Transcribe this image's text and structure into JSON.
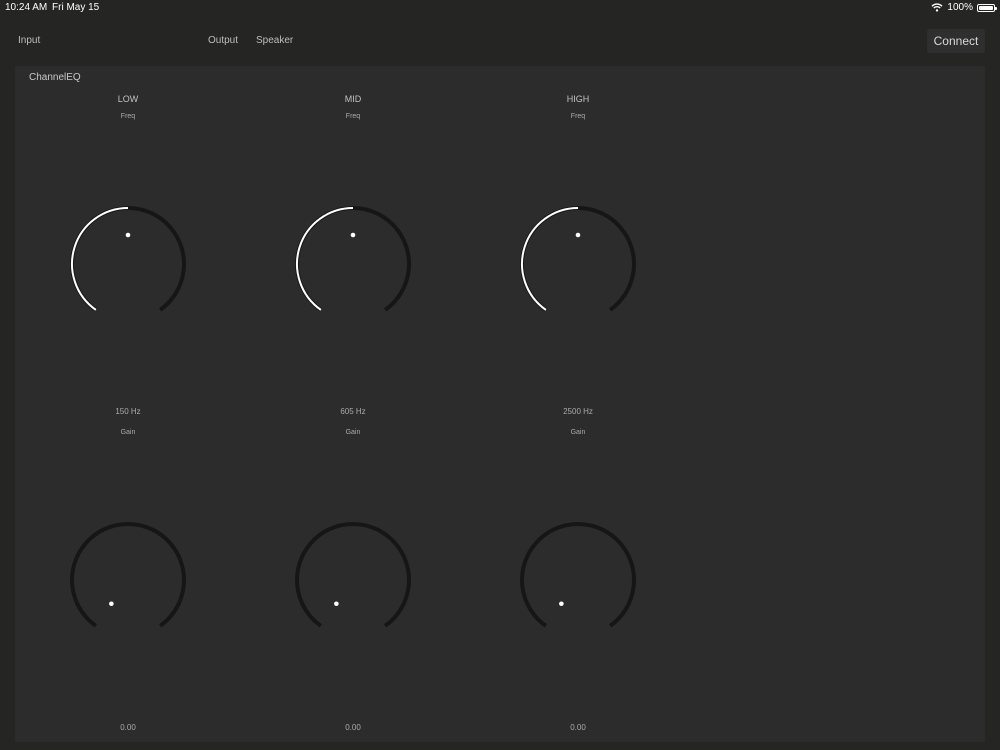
{
  "status": {
    "time": "10:24 AM",
    "date": "Fri May 15",
    "battery": "100%"
  },
  "toolbar": {
    "input_label": "Input",
    "output_label": "Output",
    "speaker_label": "Speaker",
    "connect_label": "Connect"
  },
  "panel": {
    "title": "ChannelEQ",
    "bands": [
      {
        "name": "LOW",
        "freq_label": "Freq",
        "freq_value": "150 Hz",
        "gain_label": "Gain",
        "gain_value": "0.00",
        "freq_level": 0.5,
        "gain_level": 0.0
      },
      {
        "name": "MID",
        "freq_label": "Freq",
        "freq_value": "605 Hz",
        "gain_label": "Gain",
        "gain_value": "0.00",
        "freq_level": 0.5,
        "gain_level": 0.0
      },
      {
        "name": "HIGH",
        "freq_label": "Freq",
        "freq_value": "2500 Hz",
        "gain_label": "Gain",
        "gain_value": "0.00",
        "freq_level": 0.5,
        "gain_level": 0.0
      }
    ]
  },
  "colors": {
    "background": "#252523",
    "panel": "#2c2c2c",
    "knob_track": "#161616",
    "knob_active": "#ffffff",
    "text": "#bdbdbd"
  },
  "icons": {
    "wifi": "wifi-icon",
    "battery": "battery-icon"
  }
}
